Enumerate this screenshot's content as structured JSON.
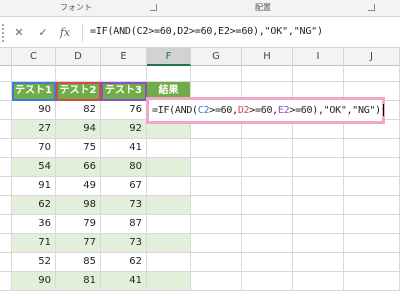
{
  "ribbon": {
    "groups": [
      {
        "label": "フォント"
      },
      {
        "label": "配置"
      }
    ]
  },
  "formula_bar": {
    "cancel_symbol": "✕",
    "enter_symbol": "✓",
    "fx_symbol": "fx",
    "formula": "=IF(AND(C2>=60,D2>=60,E2>=60),\"OK\",\"NG\")"
  },
  "columns": [
    "C",
    "D",
    "E",
    "F",
    "G",
    "H",
    "I",
    "J"
  ],
  "header_row": [
    "テスト1",
    "テスト2",
    "テスト3",
    "結果"
  ],
  "rows": [
    [
      90,
      82,
      76
    ],
    [
      27,
      94,
      92
    ],
    [
      70,
      75,
      41
    ],
    [
      54,
      66,
      80
    ],
    [
      91,
      49,
      67
    ],
    [
      62,
      98,
      73
    ],
    [
      36,
      79,
      87
    ],
    [
      71,
      77,
      73
    ],
    [
      52,
      85,
      62
    ],
    [
      90,
      81,
      41
    ]
  ],
  "edit_cell": {
    "prefix": "=IF(AND(",
    "ref_c": "C2",
    "mid1": ">=60,",
    "ref_d": "D2",
    "mid2": ">=60,",
    "ref_e": "E2",
    "suffix": ">=60),\"OK\",\"NG\")"
  },
  "colors": {
    "header_green": "#70ad47",
    "row_green": "#e2efda",
    "ref_blue": "#3b7dd8",
    "ref_red": "#d04a4a",
    "ref_purple": "#8a4fc9",
    "edit_border": "#f2a6c8"
  }
}
